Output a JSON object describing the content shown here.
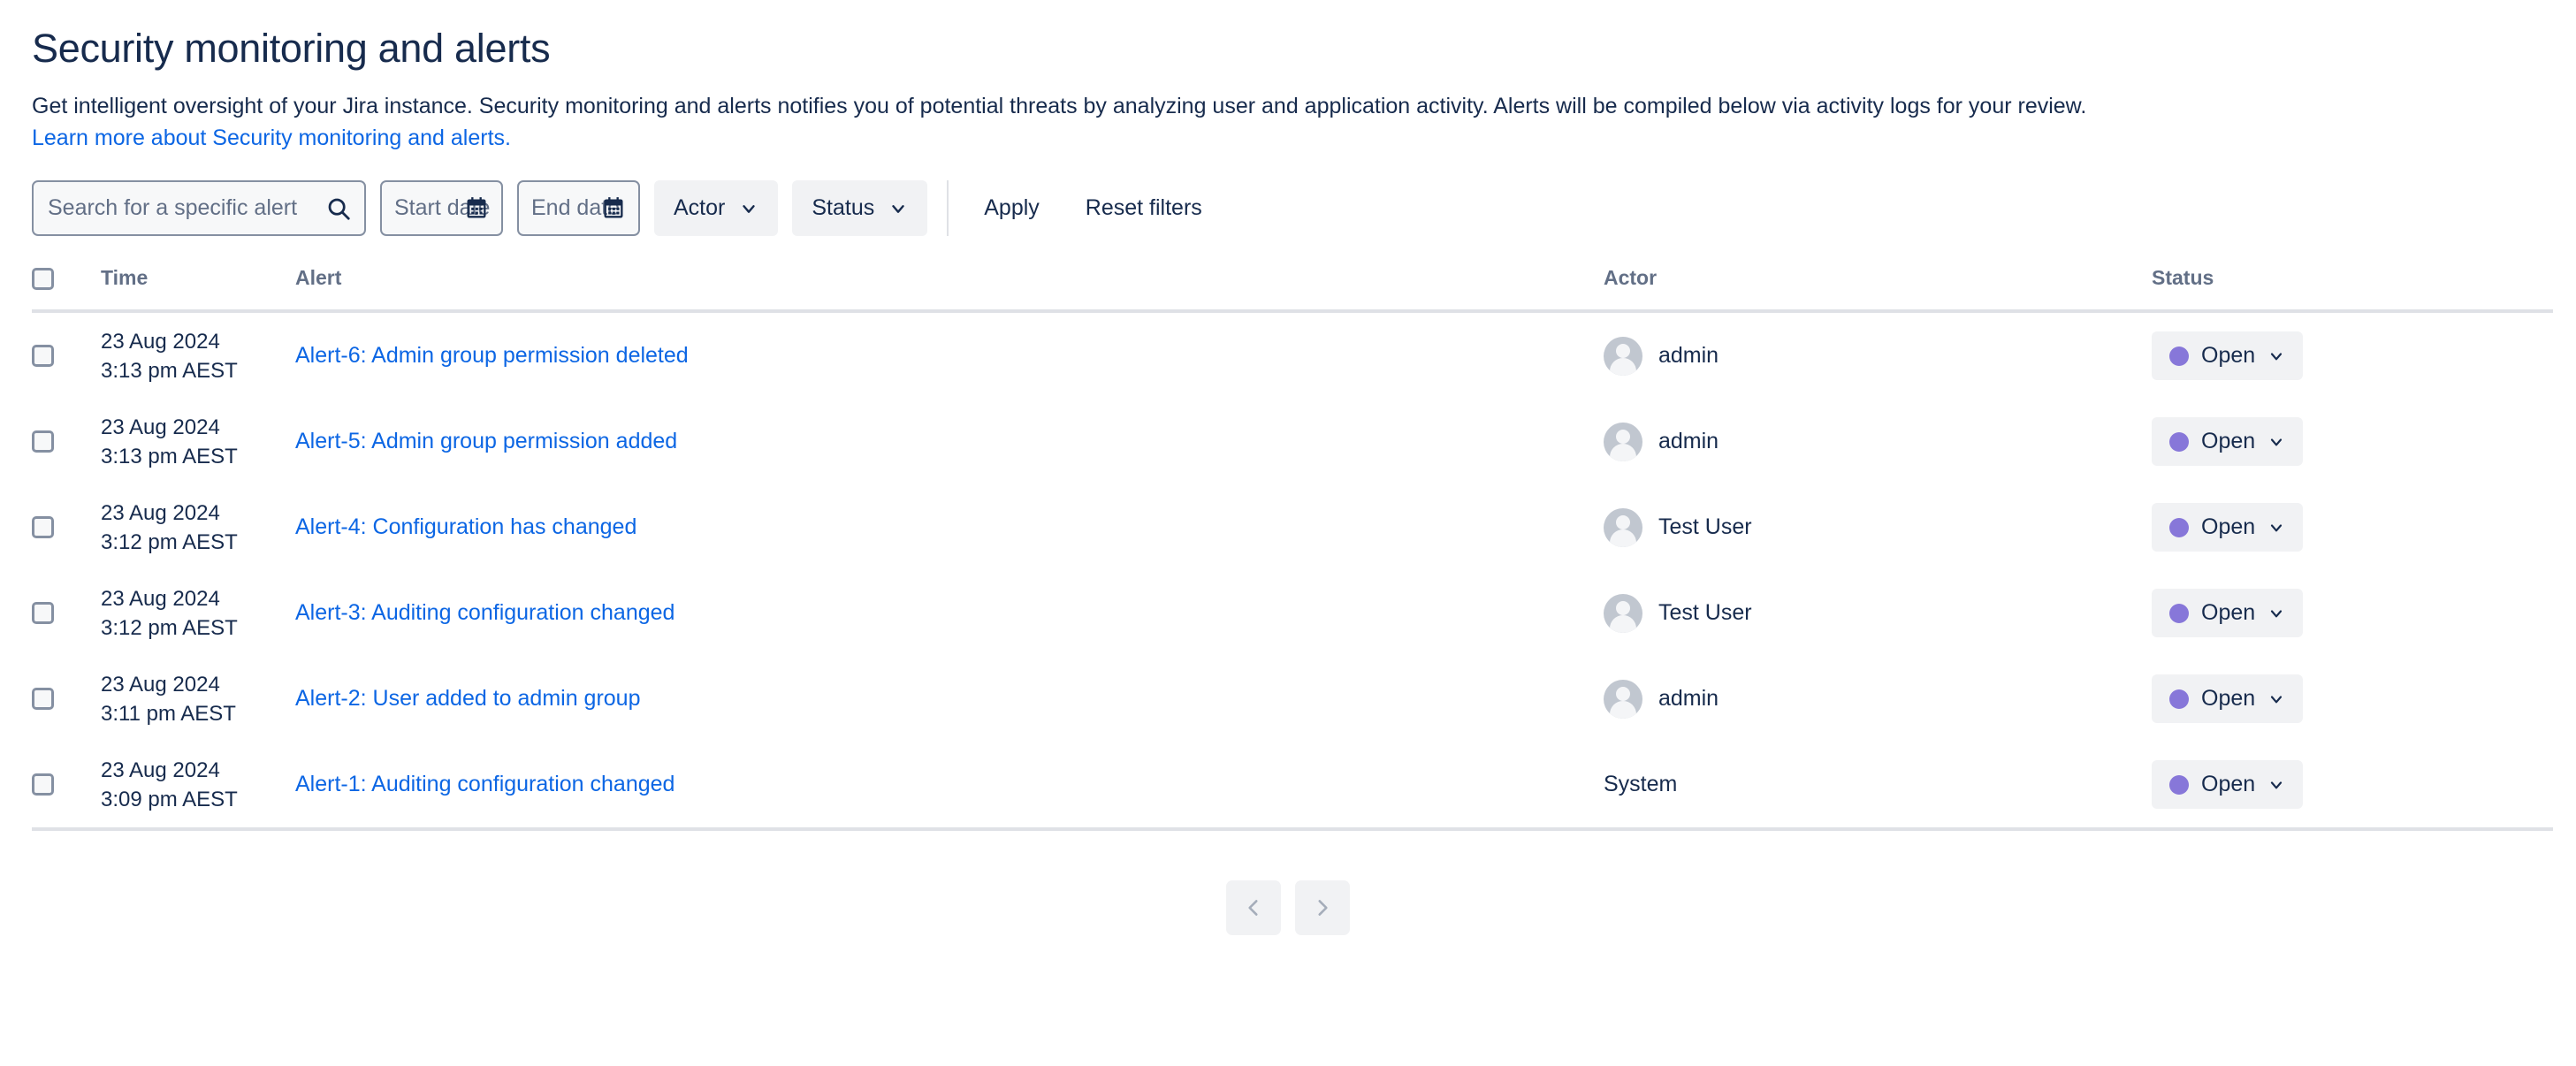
{
  "page": {
    "title": "Security monitoring and alerts",
    "description": "Get intelligent oversight of your Jira instance. Security monitoring and alerts notifies you of potential threats by analyzing user and application activity. Alerts will be compiled below via activity logs for your review.",
    "learn_more_link": "Learn more about Security monitoring and alerts."
  },
  "filters": {
    "search_placeholder": "Search for a specific alert",
    "start_date_label": "Start date",
    "end_date_label": "End date",
    "actor_label": "Actor",
    "status_label": "Status",
    "apply_label": "Apply",
    "reset_label": "Reset filters"
  },
  "table": {
    "headers": {
      "time": "Time",
      "alert": "Alert",
      "actor": "Actor",
      "status": "Status"
    },
    "rows": [
      {
        "date": "23 Aug 2024",
        "time": "3:13 pm AEST",
        "alert": "Alert-6: Admin group permission deleted",
        "actor": "admin",
        "has_avatar": true,
        "status": "Open"
      },
      {
        "date": "23 Aug 2024",
        "time": "3:13 pm AEST",
        "alert": "Alert-5: Admin group permission added",
        "actor": "admin",
        "has_avatar": true,
        "status": "Open"
      },
      {
        "date": "23 Aug 2024",
        "time": "3:12 pm AEST",
        "alert": "Alert-4: Configuration has changed",
        "actor": "Test User",
        "has_avatar": true,
        "status": "Open"
      },
      {
        "date": "23 Aug 2024",
        "time": "3:12 pm AEST",
        "alert": "Alert-3: Auditing configuration changed",
        "actor": "Test User",
        "has_avatar": true,
        "status": "Open"
      },
      {
        "date": "23 Aug 2024",
        "time": "3:11 pm AEST",
        "alert": "Alert-2: User added to admin group",
        "actor": "admin",
        "has_avatar": true,
        "status": "Open"
      },
      {
        "date": "23 Aug 2024",
        "time": "3:09 pm AEST",
        "alert": "Alert-1: Auditing configuration changed",
        "actor": "System",
        "has_avatar": false,
        "status": "Open"
      }
    ]
  },
  "pagination": {
    "prev_icon": "chevron-left-icon",
    "next_icon": "chevron-right-icon"
  },
  "icons": {
    "search": "search-icon",
    "calendar": "calendar-icon",
    "chevron_down": "chevron-down-icon",
    "avatar": "avatar-icon"
  },
  "colors": {
    "link": "#0C66E4",
    "text": "#172B4D",
    "muted": "#626F86",
    "status_dot": "#8777D9",
    "badge_bg": "#F1F2F4",
    "border": "#DFE1E6"
  }
}
